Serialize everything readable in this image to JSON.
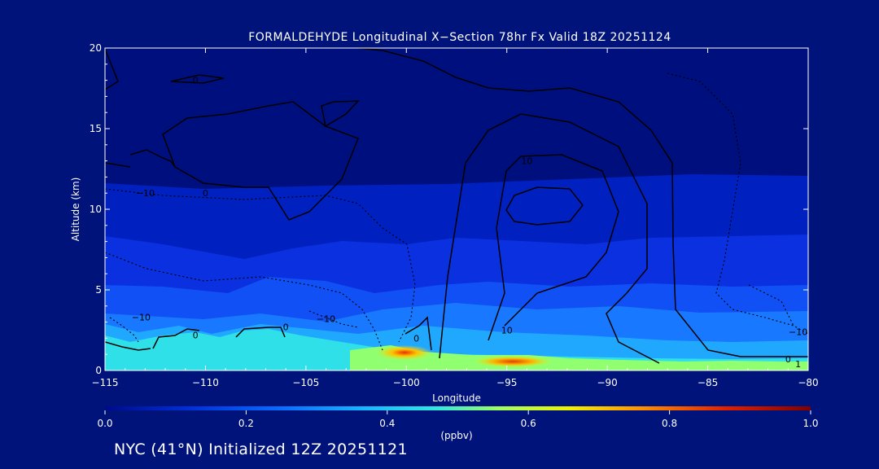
{
  "chart_data": {
    "type": "contour",
    "title": "FORMALDEHYDE Longitudinal X−Section 78hr  Fx Valid 18Z 20251124",
    "xlabel": "Longitude",
    "ylabel": "Altitude (km)",
    "xlim": [
      -115,
      -80
    ],
    "ylim": [
      0,
      20
    ],
    "x_ticks": [
      -115,
      -110,
      -105,
      -100,
      -95,
      -90,
      -85,
      -80
    ],
    "x_tick_labels": [
      "−115",
      "−110",
      "−105",
      "−100",
      "−95",
      "−90",
      "−85",
      "−80"
    ],
    "y_ticks": [
      0,
      5,
      10,
      15,
      20
    ],
    "y_tick_labels": [
      "0",
      "5",
      "10",
      "15",
      "20"
    ],
    "grid": false,
    "colorbar": {
      "label": "(ppbv)",
      "min": 0.0,
      "max": 1.0,
      "ticks": [
        0.0,
        0.2,
        0.4,
        0.6,
        0.8,
        1.0
      ],
      "tick_labels": [
        "0.0",
        "0.2",
        "0.4",
        "0.6",
        "0.8",
        "1.0"
      ],
      "colors": [
        "#000a8a",
        "#0030d8",
        "#0a6cff",
        "#18b8ff",
        "#30e8e0",
        "#a0ff60",
        "#f0f000",
        "#ff9000",
        "#e02000",
        "#800000"
      ]
    },
    "filled_concentration_ppbv": {
      "peaks": [
        {
          "lon": -100,
          "alt": 1.0,
          "value": 0.85
        },
        {
          "lon": -95,
          "alt": 0.5,
          "value": 0.75
        }
      ],
      "background_aloft": 0.02,
      "boundary_layer_band": 0.4
    },
    "contour_labels": [
      {
        "lon": -110.5,
        "alt": 18.0,
        "text": "0"
      },
      {
        "lon": -110.0,
        "alt": 11.0,
        "text": "0"
      },
      {
        "lon": -113.0,
        "alt": 11.0,
        "text": "−10"
      },
      {
        "lon": -94.0,
        "alt": 13.0,
        "text": "10"
      },
      {
        "lon": -95.0,
        "alt": 2.5,
        "text": "10"
      },
      {
        "lon": -110.5,
        "alt": 2.2,
        "text": "0"
      },
      {
        "lon": -106.0,
        "alt": 2.7,
        "text": "0"
      },
      {
        "lon": -113.2,
        "alt": 3.3,
        "text": "−10"
      },
      {
        "lon": -104.0,
        "alt": 3.2,
        "text": "−10"
      },
      {
        "lon": -99.5,
        "alt": 2.0,
        "text": "0"
      },
      {
        "lon": -81.0,
        "alt": 0.7,
        "text": "0"
      },
      {
        "lon": -80.5,
        "alt": 2.4,
        "text": "−10"
      },
      {
        "lon": -80.5,
        "alt": 0.4,
        "text": "1"
      }
    ]
  },
  "footer": "NYC (41°N) Initialized 12Z 20251121"
}
